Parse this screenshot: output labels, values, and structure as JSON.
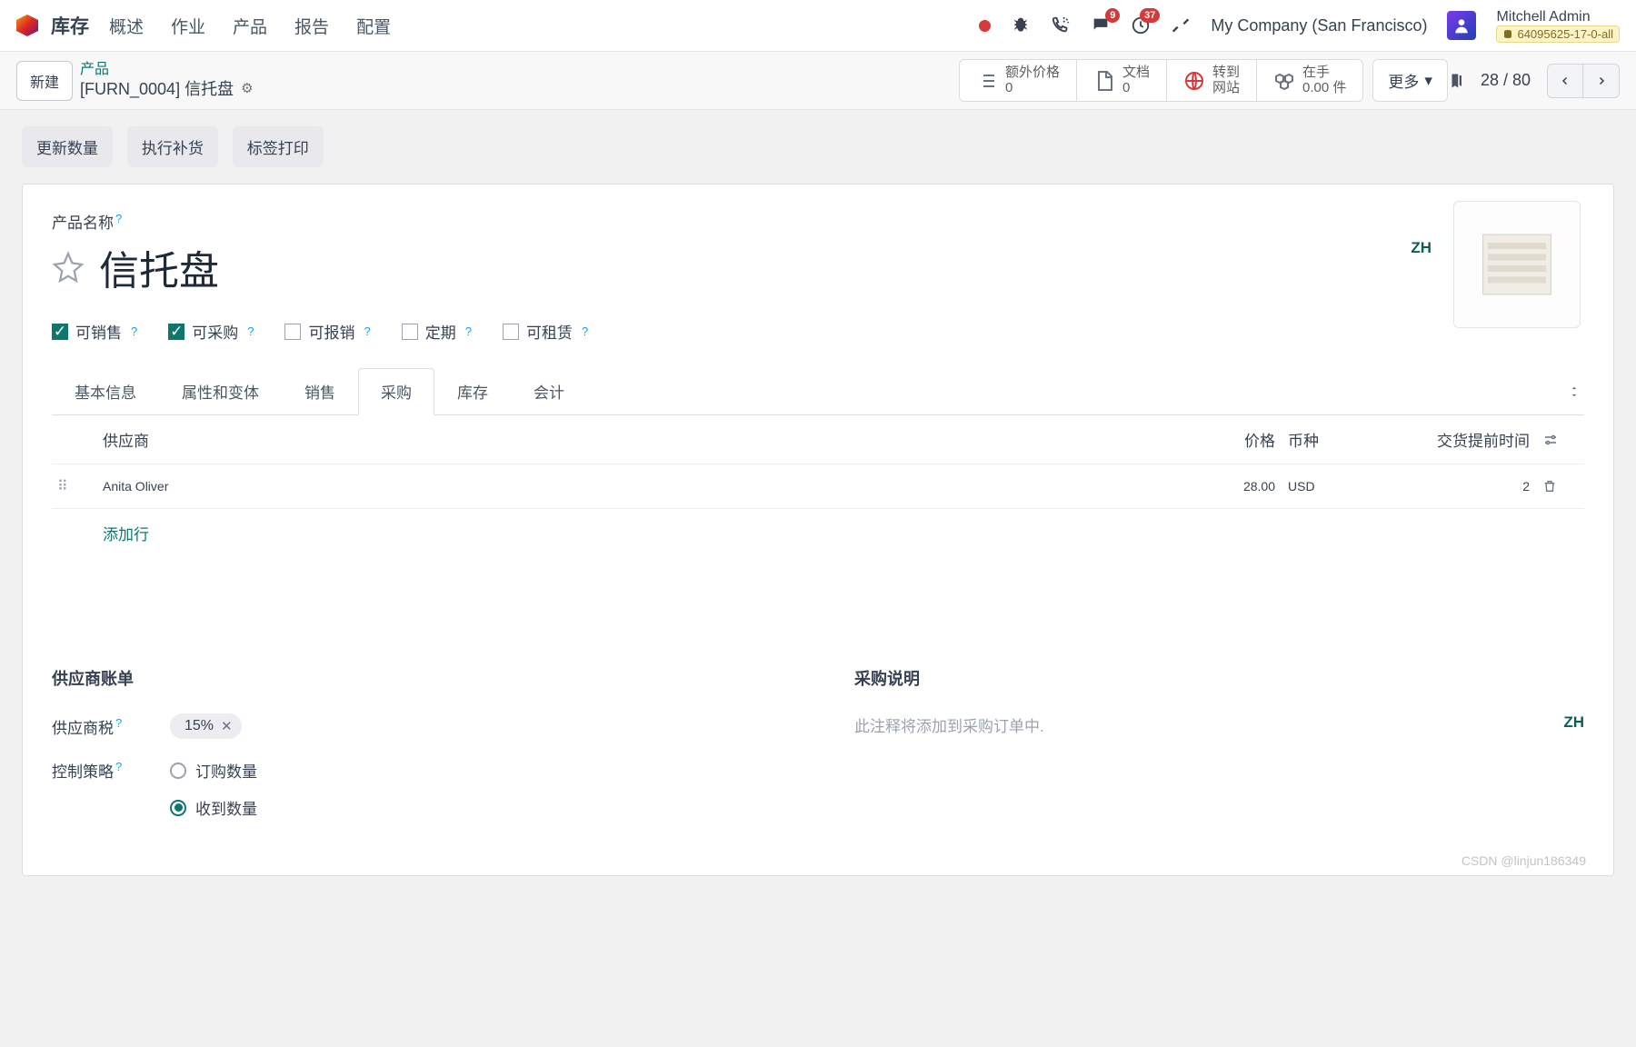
{
  "nav": {
    "brand": "库存",
    "menu": [
      "概述",
      "作业",
      "产品",
      "报告",
      "配置"
    ],
    "badges": {
      "msg": "9",
      "activity": "37"
    },
    "company": "My Company (San Francisco)",
    "user": "Mitchell Admin",
    "db": "64095625-17-0-all"
  },
  "control": {
    "newBtn": "新建",
    "bcTop": "产品",
    "bcBot": "[FURN_0004] 信托盘",
    "stats": [
      {
        "label": "额外价格",
        "value": "0"
      },
      {
        "label": "文档",
        "value": "0"
      },
      {
        "label": "转到",
        "value": "网站"
      },
      {
        "label": "在手",
        "value": "0.00 件"
      }
    ],
    "more": "更多",
    "pager": "28 / 80"
  },
  "actions": [
    "更新数量",
    "执行补货",
    "标签打印"
  ],
  "product": {
    "nameLabel": "产品名称",
    "title": "信托盘",
    "lang": "ZH",
    "checks": [
      {
        "label": "可销售",
        "on": true,
        "help": true
      },
      {
        "label": "可采购",
        "on": true,
        "help": true
      },
      {
        "label": "可报销",
        "on": false,
        "help": true
      },
      {
        "label": "定期",
        "on": false,
        "help": true
      },
      {
        "label": "可租赁",
        "on": false,
        "help": true
      }
    ]
  },
  "tabs": [
    "基本信息",
    "属性和变体",
    "销售",
    "采购",
    "库存",
    "会计"
  ],
  "activeTab": 3,
  "table": {
    "headers": {
      "vendor": "供应商",
      "price": "价格",
      "currency": "币种",
      "lead": "交货提前时间"
    },
    "rows": [
      {
        "vendor": "Anita Oliver",
        "price": "28.00",
        "currency": "USD",
        "lead": "2"
      }
    ],
    "addLine": "添加行"
  },
  "bottom": {
    "billTitle": "供应商账单",
    "taxLabel": "供应商税",
    "taxTag": "15%",
    "policyLabel": "控制策略",
    "policy": [
      "订购数量",
      "收到数量"
    ],
    "policySel": 1,
    "descTitle": "采购说明",
    "descPh": "此注释将添加到采购订单中.",
    "lang": "ZH"
  },
  "wm": "CSDN @linjun186349"
}
